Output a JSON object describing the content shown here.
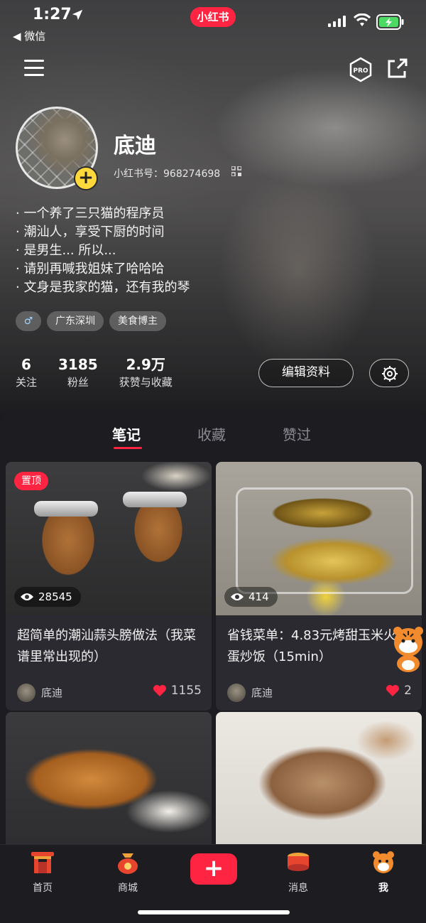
{
  "status_bar": {
    "time": "1:27",
    "back_app": "◀ 微信",
    "app_badge": "小红书"
  },
  "profile": {
    "username": "底迪",
    "user_id": "小红书号：968274698",
    "bio": [
      "· 一个养了三只猫的程序员",
      "· 潮汕人，享受下厨的时间",
      "· 是男生... 所以...",
      "· 请别再喊我姐妹了哈哈哈",
      "· 文身是我家的猫，还有我的琴"
    ],
    "tags": {
      "gender": "♂",
      "location": "广东深圳",
      "category": "美食博主"
    },
    "stats": [
      {
        "num": "6",
        "label": "关注"
      },
      {
        "num": "3185",
        "label": "粉丝"
      },
      {
        "num": "2.9万",
        "label": "获赞与收藏"
      }
    ],
    "edit_label": "编辑资料"
  },
  "tabs": [
    "笔记",
    "收藏",
    "赞过"
  ],
  "cards": [
    {
      "pinned": "置顶",
      "views": "28545",
      "title": "超简单的潮汕蒜头膀做法（我菜谱里常出现的）",
      "author": "底迪",
      "likes": "1155"
    },
    {
      "views": "414",
      "title": "省钱菜单：4.83元烤甜玉米火腿蛋炒饭（15min）",
      "author": "底迪",
      "likes": "2"
    },
    {
      "views": "",
      "title": "",
      "author": "",
      "likes": ""
    },
    {
      "views": "",
      "title": "",
      "author": "",
      "likes": ""
    }
  ],
  "bottom_nav": {
    "home": "首页",
    "shop": "商城",
    "post": "+",
    "messages": "消息",
    "me": "我"
  },
  "colors": {
    "brand": "#ff2442",
    "background": "#1c1c21",
    "card": "#2a2a30"
  }
}
